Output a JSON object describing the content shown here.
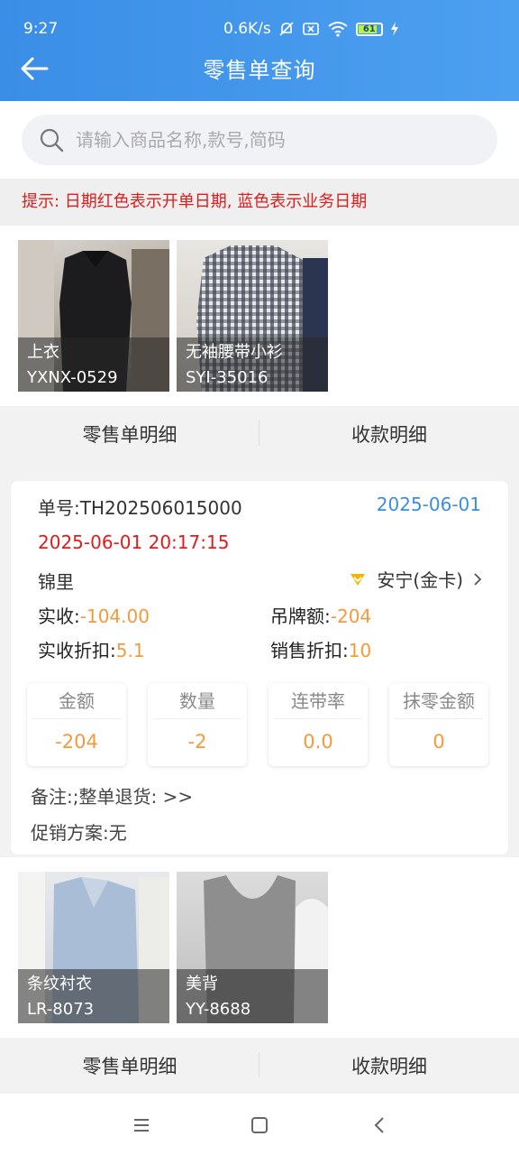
{
  "status_bar": {
    "time": "9:27",
    "speed": "0.6K/s",
    "battery": "61"
  },
  "nav": {
    "title": "零售单查询"
  },
  "search": {
    "placeholder": "请输入商品名称,款号,简码"
  },
  "tip": "提示: 日期红色表示开单日期, 蓝色表示业务日期",
  "orders": [
    {
      "items": [
        {
          "name": "上衣",
          "code": "YXNX-0529"
        },
        {
          "name": "无袖腰带小衫",
          "code": "SYI-35016"
        }
      ],
      "tabs": [
        "零售单明细",
        "收款明细"
      ],
      "order_no": "单号:TH202506015000",
      "business_date": "2025-06-01",
      "open_datetime": "2025-06-01 20:17:15",
      "store": "锦里",
      "member": "安宁(金卡)",
      "actual_received_label": "实收:",
      "actual_received_value": "-104.00",
      "tag_amount_label": "吊牌额:",
      "tag_amount_value": "-204",
      "actual_discount_label": "实收折扣:",
      "actual_discount_value": "5.1",
      "sales_discount_label": "销售折扣:",
      "sales_discount_value": "10",
      "stats": [
        {
          "label": "金额",
          "value": "-204"
        },
        {
          "label": "数量",
          "value": "-2"
        },
        {
          "label": "连带率",
          "value": "0.0"
        },
        {
          "label": "抹零金额",
          "value": "0"
        }
      ],
      "remark": "备注:;整单退货: >>",
      "promotion": "促销方案:无"
    },
    {
      "items": [
        {
          "name": "条纹衬衣",
          "code": "LR-8073"
        },
        {
          "name": "美背",
          "code": "YY-8688"
        }
      ],
      "tabs": [
        "零售单明细",
        "收款明细"
      ]
    }
  ],
  "colors": {
    "header": "#3a8ee6",
    "open_date": "#e01c1c",
    "business_date": "#3c8de0",
    "value": "#f59a3b"
  }
}
